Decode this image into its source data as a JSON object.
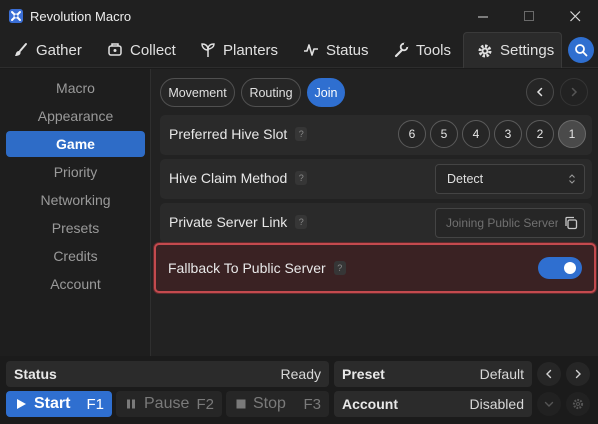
{
  "app": {
    "title": "Revolution Macro"
  },
  "tabs": [
    {
      "label": "Gather",
      "icon": "brush-icon"
    },
    {
      "label": "Collect",
      "icon": "collect-icon"
    },
    {
      "label": "Planters",
      "icon": "sprout-icon"
    },
    {
      "label": "Status",
      "icon": "pulse-icon"
    },
    {
      "label": "Tools",
      "icon": "wrench-icon"
    },
    {
      "label": "Settings",
      "icon": "gear-icon"
    }
  ],
  "active_tab": "Settings",
  "sidebar": {
    "items": [
      {
        "label": "Macro"
      },
      {
        "label": "Appearance"
      },
      {
        "label": "Game"
      },
      {
        "label": "Priority"
      },
      {
        "label": "Networking"
      },
      {
        "label": "Presets"
      },
      {
        "label": "Credits"
      },
      {
        "label": "Account"
      }
    ],
    "active": "Game"
  },
  "subtabs": [
    {
      "label": "Movement"
    },
    {
      "label": "Routing"
    },
    {
      "label": "Join"
    }
  ],
  "active_subtab": "Join",
  "settings": {
    "hive_slot": {
      "label": "Preferred Hive Slot",
      "help": "?",
      "slots": [
        "6",
        "5",
        "4",
        "3",
        "2",
        "1"
      ],
      "selected": "1"
    },
    "hive_claim": {
      "label": "Hive Claim Method",
      "help": "?",
      "value": "Detect"
    },
    "private_server": {
      "label": "Private Server Link",
      "help": "?",
      "placeholder": "Joining Public Server"
    },
    "fallback": {
      "label": "Fallback To Public Server",
      "help": "?",
      "enabled": true
    }
  },
  "status_bar": {
    "status_label": "Status",
    "status_value": "Ready",
    "preset_label": "Preset",
    "preset_value": "Default",
    "account_label": "Account",
    "account_value": "Disabled",
    "start": {
      "label": "Start",
      "key": "F1"
    },
    "pause": {
      "label": "Pause",
      "key": "F2"
    },
    "stop": {
      "label": "Stop",
      "key": "F3"
    }
  },
  "colors": {
    "accent": "#2f6fd0",
    "highlight_border": "#c44a4e"
  }
}
